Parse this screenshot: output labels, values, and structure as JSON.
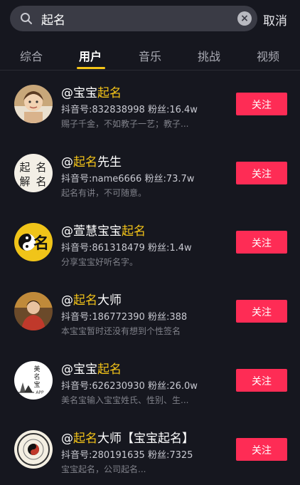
{
  "search": {
    "query": "起名",
    "cancel_label": "取消"
  },
  "tabs": [
    {
      "label": "综合",
      "active": false
    },
    {
      "label": "用户",
      "active": true
    },
    {
      "label": "音乐",
      "active": false
    },
    {
      "label": "挑战",
      "active": false
    },
    {
      "label": "视频",
      "active": false
    }
  ],
  "colors": {
    "accent": "#f5c518",
    "follow": "#fe2c55",
    "background": "#16171f"
  },
  "users": [
    {
      "name_parts": [
        "@宝宝",
        "起名",
        ""
      ],
      "meta": "抖音号:832838998  粉丝:16.4w",
      "bio": "赐子千金，不如教子一艺；教子...",
      "follow_label": "关注",
      "avatar_icon": "baby-photo-avatar"
    },
    {
      "name_parts": [
        "@",
        "起名",
        "先生"
      ],
      "meta": "抖音号:name6666  粉丝:73.7w",
      "bio": "起名有讲，不可随意。",
      "follow_label": "关注",
      "avatar_icon": "calligraphy-avatar",
      "avatar_text": [
        "起",
        "名",
        "解",
        "名"
      ]
    },
    {
      "name_parts": [
        "@萱慧宝宝",
        "起名",
        ""
      ],
      "meta": "抖音号:861318479  粉丝:1.4w",
      "bio": "分享宝宝好听名字。",
      "follow_label": "关注",
      "avatar_icon": "yin-yang-avatar",
      "avatar_text": [
        "名"
      ]
    },
    {
      "name_parts": [
        "@",
        "起名",
        "大师"
      ],
      "meta": "抖音号:186772390  粉丝:388",
      "bio": "本宝宝暂时还没有想到个性签名",
      "follow_label": "关注",
      "avatar_icon": "person-photo-avatar"
    },
    {
      "name_parts": [
        "@宝宝",
        "起名",
        ""
      ],
      "meta": "抖音号:626230930  粉丝:26.0w",
      "bio": "美名宝输入宝宝姓氏、性别、生...",
      "follow_label": "关注",
      "avatar_icon": "app-logo-avatar",
      "avatar_text": [
        "美",
        "名",
        "宝",
        "APP"
      ]
    },
    {
      "name_parts": [
        "@",
        "起名",
        "大师【宝宝起名】"
      ],
      "meta": "抖音号:280191635  粉丝:7325",
      "bio": "宝宝起名，公司起名...",
      "follow_label": "关注",
      "avatar_icon": "bagua-avatar"
    }
  ]
}
